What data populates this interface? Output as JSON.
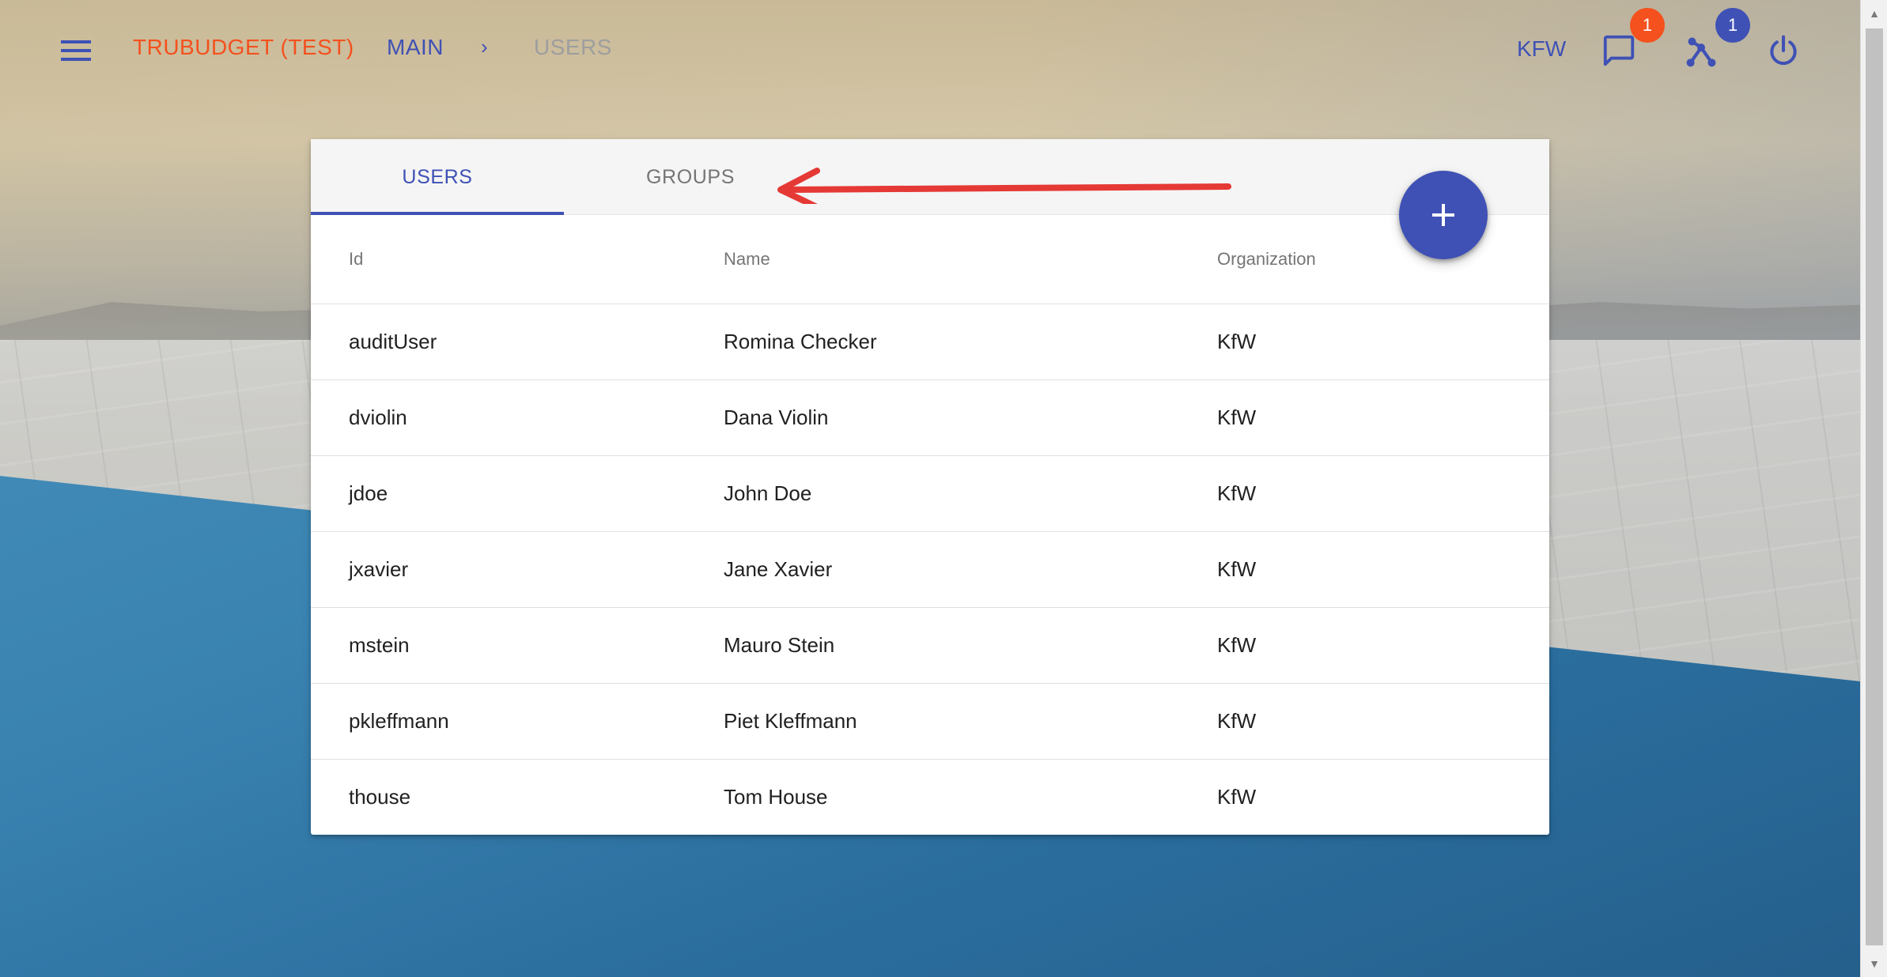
{
  "topbar": {
    "app_title": "TRUBUDGET (TEST)",
    "breadcrumb_main": "MAIN",
    "breadcrumb_separator": "›",
    "breadcrumb_current": "USERS",
    "organization": "KFW",
    "notifications_count": "1",
    "network_count": "1",
    "icons": [
      "menu-icon",
      "chat-bubble-icon",
      "network-icon",
      "power-icon"
    ]
  },
  "tabs": [
    {
      "label": "USERS",
      "active": true
    },
    {
      "label": "GROUPS",
      "active": false
    }
  ],
  "fab": {
    "icon": "plus-icon"
  },
  "table": {
    "columns": [
      "Id",
      "Name",
      "Organization"
    ],
    "rows": [
      {
        "id": "auditUser",
        "name": "Romina Checker",
        "organization": "KfW"
      },
      {
        "id": "dviolin",
        "name": "Dana Violin",
        "organization": "KfW"
      },
      {
        "id": "jdoe",
        "name": "John Doe",
        "organization": "KfW"
      },
      {
        "id": "jxavier",
        "name": "Jane Xavier",
        "organization": "KfW"
      },
      {
        "id": "mstein",
        "name": "Mauro Stein",
        "organization": "KfW"
      },
      {
        "id": "pkleffmann",
        "name": "Piet Kleffmann",
        "organization": "KfW"
      },
      {
        "id": "thouse",
        "name": "Tom House",
        "organization": "KfW"
      }
    ]
  },
  "colors": {
    "primary": "#3f51b5",
    "accent": "#f4511e",
    "annotation_arrow": "#e53935"
  }
}
